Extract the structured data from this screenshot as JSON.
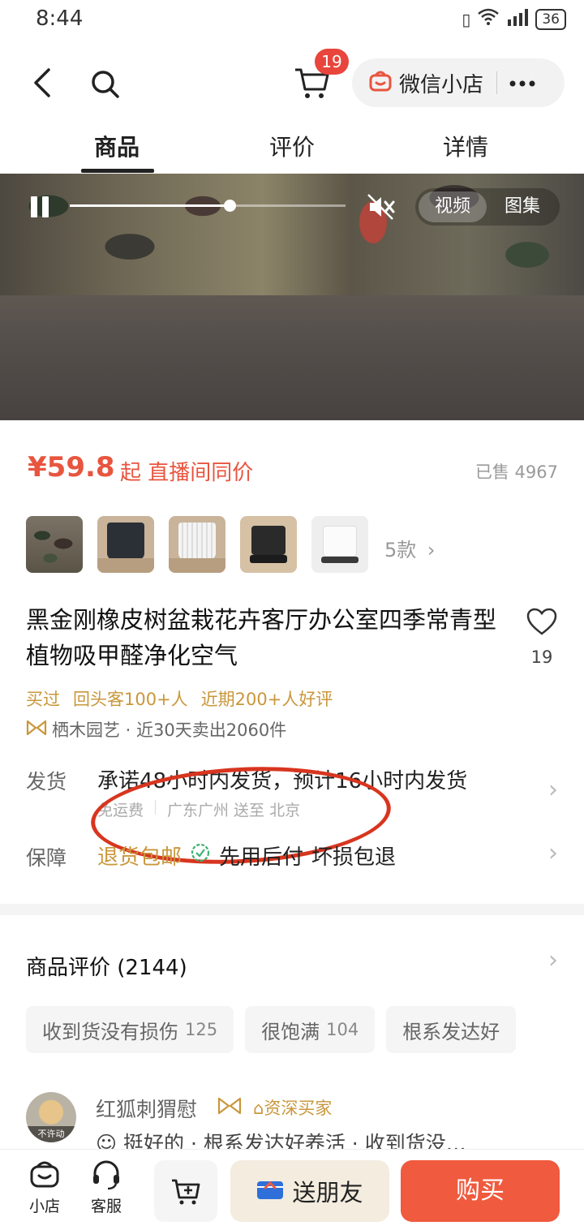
{
  "status_bar": {
    "time": "8:44",
    "battery": "36"
  },
  "nav": {
    "cart_badge": "19",
    "shop_label": "微信小店"
  },
  "tabs": [
    {
      "label": "商品"
    },
    {
      "label": "评价"
    },
    {
      "label": "详情"
    }
  ],
  "media": {
    "progress_fraction": 0.58,
    "toggle": [
      {
        "label": "视频"
      },
      {
        "label": "图集"
      }
    ]
  },
  "product": {
    "price": "¥59.8",
    "price_note": "起 直播间同价",
    "sold": "已售 4967",
    "variants_more": "5款",
    "title": "黑金刚橡皮树盆栽花卉客厅办公室四季常青型植物吸甲醛净化空气",
    "fav_count": "19",
    "tags": [
      "买过",
      "回头客100+人",
      "近期200+人好评"
    ],
    "shop_line": "栖木园艺 · 近30天卖出2060件"
  },
  "shipping": {
    "label": "发货",
    "main": "承诺48小时内发货，预计16小时内发货",
    "free": "免运费",
    "route": "广东广州 送至 北京"
  },
  "guarantee": {
    "label": "保障",
    "items": [
      "退货包邮",
      "先用后付",
      "坏损包退"
    ]
  },
  "reviews": {
    "title": "商品评价 (2144)",
    "chips": [
      {
        "label": "收到货没有损伤",
        "count": "125"
      },
      {
        "label": "很饱满",
        "count": "104"
      },
      {
        "label": "根系发达好",
        "count": ""
      }
    ],
    "first": {
      "avatar_badge": "不许动",
      "name": "红狐刺猬慰",
      "level": "资深买家",
      "text": "挺好的 · 根系发达好养活 · 收到货没…"
    }
  },
  "bottom_bar": {
    "shop": "小店",
    "service": "客服",
    "send_friend": "送朋友",
    "buy": "购买"
  },
  "colors": {
    "accent": "#e8553f",
    "gold": "#c9973b",
    "annotation": "#d8351f"
  }
}
